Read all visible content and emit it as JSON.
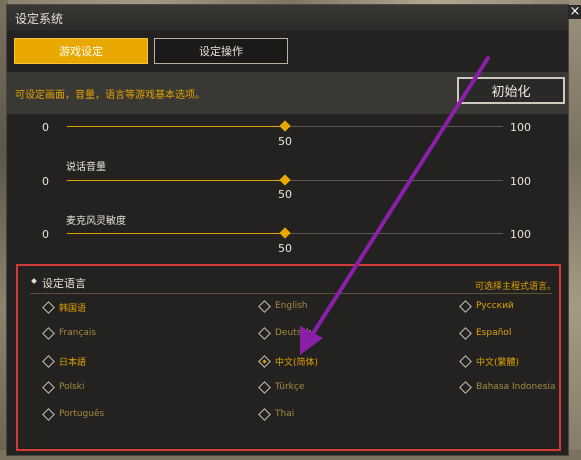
{
  "window": {
    "title": "设定系统",
    "close_glyph": "×"
  },
  "tabs": [
    {
      "label": "游戏设定",
      "active": true
    },
    {
      "label": "设定操作",
      "active": false
    }
  ],
  "description": "可设定画面，音量，语言等游戏基本选项。",
  "reset_label": "初始化",
  "sliders": [
    {
      "label": "",
      "min": "0",
      "max": "100",
      "value": "50",
      "fraction": 0.5
    },
    {
      "label": "说话音量",
      "min": "0",
      "max": "100",
      "value": "50",
      "fraction": 0.5
    },
    {
      "label": "麦克风灵敏度",
      "min": "0",
      "max": "100",
      "value": "50",
      "fraction": 0.5
    }
  ],
  "language": {
    "title": "设定语言",
    "hint": "可选择主程式语言。",
    "options": [
      {
        "label": "韩国语",
        "selected": false
      },
      {
        "label": "English",
        "selected": false
      },
      {
        "label": "Русский",
        "selected": false
      },
      {
        "label": "Français",
        "selected": false
      },
      {
        "label": "Deutsch",
        "selected": false
      },
      {
        "label": "Español",
        "selected": false
      },
      {
        "label": "日本語",
        "selected": false
      },
      {
        "label": "中文(简体)",
        "selected": true
      },
      {
        "label": "中文(繁體)",
        "selected": false
      },
      {
        "label": "Polski",
        "selected": false
      },
      {
        "label": "Türkçe",
        "selected": false
      },
      {
        "label": "Bahasa Indonesia",
        "selected": false
      },
      {
        "label": "Português",
        "selected": false
      },
      {
        "label": "Thai",
        "selected": false
      }
    ]
  },
  "colors": {
    "accent": "#e9a800",
    "highlight_border": "#d43a3a",
    "annotation_arrow": "#8a1fa8"
  }
}
